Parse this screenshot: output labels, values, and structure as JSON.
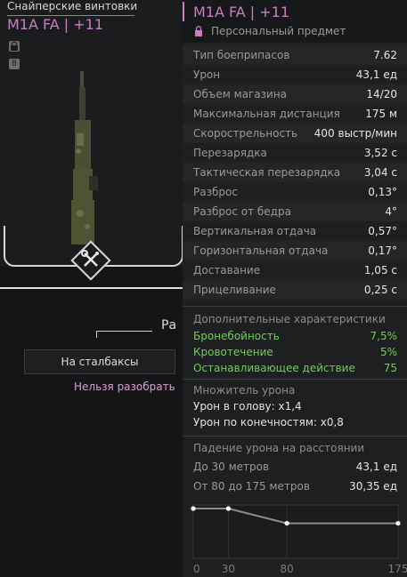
{
  "card": {
    "category": "Снайперские винтовки",
    "title": "M1A FA | +11",
    "lock_glyph": "🔒",
    "level_glyph": "8",
    "partial_action": "Ра",
    "stash_button": "На сталбаксы",
    "no_disassemble": "Нельзя разобрать"
  },
  "tooltip": {
    "title": "M1A FA | +11",
    "subtitle": "Персональный предмет",
    "stats": [
      {
        "label": "Тип боеприпасов",
        "value": "7.62"
      },
      {
        "label": "Урон",
        "value": "43,1 ед"
      },
      {
        "label": "Объем магазина",
        "value": "14/20"
      },
      {
        "label": "Максимальная дистанция",
        "value": "175 м"
      },
      {
        "label": "Скорострельность",
        "value": "400 выстр/мин"
      },
      {
        "label": "Перезарядка",
        "value": "3,52 с"
      },
      {
        "label": "Тактическая перезарядка",
        "value": "3,04 с"
      },
      {
        "label": "Разброс",
        "value": "0,13°"
      },
      {
        "label": "Разброс от бедра",
        "value": "4°"
      },
      {
        "label": "Вертикальная отдача",
        "value": "0,57°"
      },
      {
        "label": "Горизонтальная отдача",
        "value": "0,17°"
      },
      {
        "label": "Доставание",
        "value": "1,05 с"
      },
      {
        "label": "Прицеливание",
        "value": "0,25 с"
      }
    ],
    "extra": {
      "title": "Дополнительные характеристики",
      "items": [
        {
          "label": "Бронебойность",
          "value": "7,5%"
        },
        {
          "label": "Кровотечение",
          "value": "5%"
        },
        {
          "label": "Останавливающее действие",
          "value": "75"
        }
      ]
    },
    "multiplier": {
      "title": "Множитель урона",
      "head": "Урон в голову: x1,4",
      "limbs": "Урон по конечностям: x0,8"
    },
    "falloff": {
      "title": "Падение урона на расстоянии",
      "rows": [
        {
          "label": "До 30 метров",
          "value": "43,1 ед"
        },
        {
          "label": "От 80 до 175 метров",
          "value": "30,35 ед"
        }
      ]
    }
  },
  "chart_data": {
    "type": "line",
    "x": [
      0,
      30,
      80,
      175
    ],
    "y": [
      43.1,
      43.1,
      30.35,
      30.35
    ],
    "xticks": [
      "0",
      "30",
      "80",
      "175"
    ],
    "xlim": [
      0,
      175
    ],
    "ylim": [
      0,
      43.1
    ]
  }
}
